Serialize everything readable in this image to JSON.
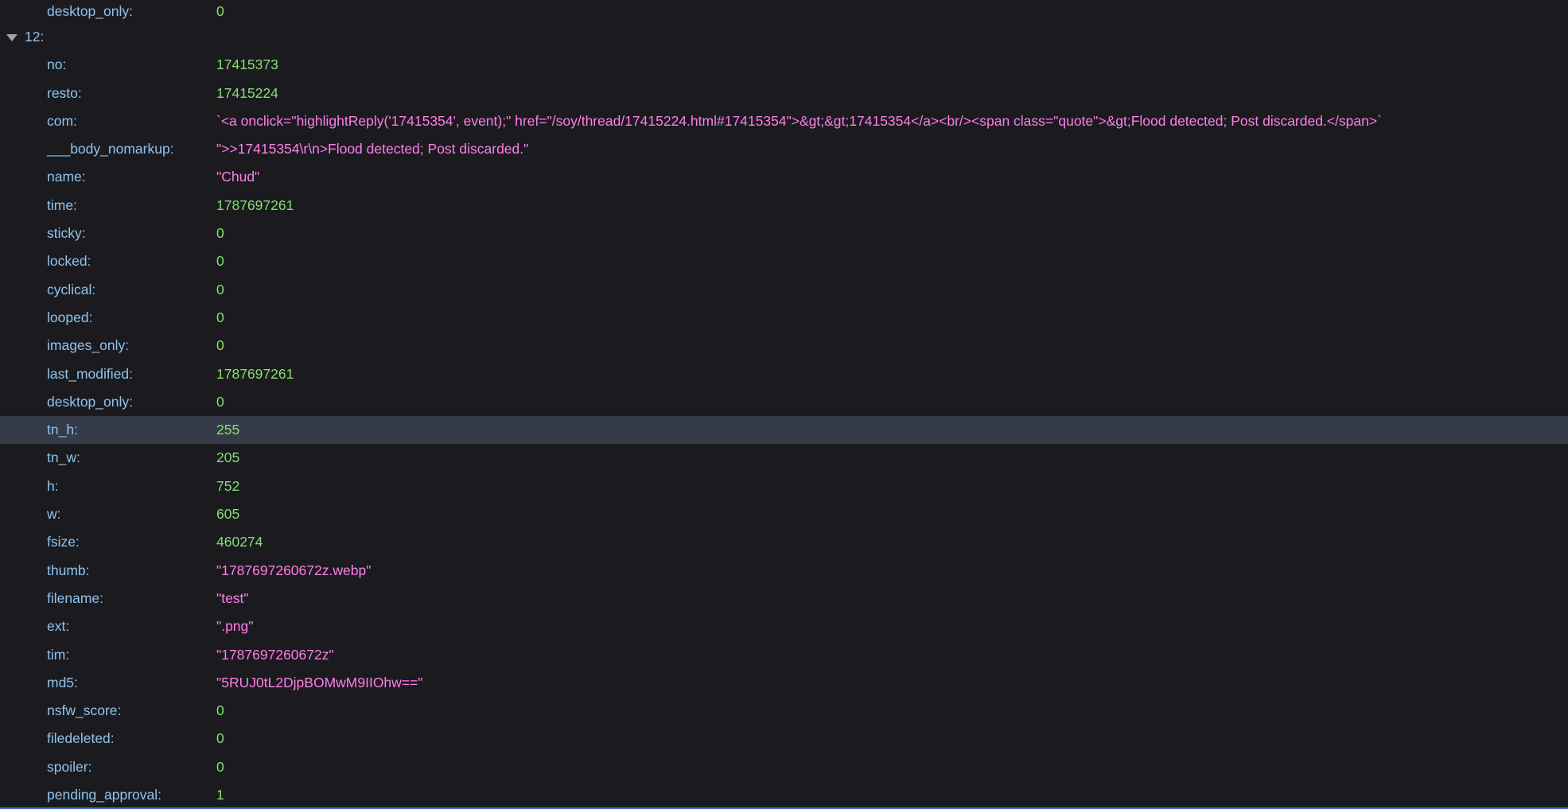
{
  "top_row": {
    "key": "desktop_only:",
    "value": "0"
  },
  "group": {
    "label": "12:"
  },
  "rows": [
    {
      "key": "no:",
      "value": "17415373",
      "type": "num"
    },
    {
      "key": "resto:",
      "value": "17415224",
      "type": "num"
    },
    {
      "key": "com:",
      "value": "`<a onclick=\"highlightReply('17415354', event);\" href=\"/soy/thread/17415224.html#17415354\">&gt;&gt;17415354</a><br/><span class=\"quote\">&gt;Flood detected; Post discarded.</span>`",
      "type": "str"
    },
    {
      "key": "___body_nomarkup:",
      "value": "\">>17415354\\r\\n>Flood detected; Post discarded.\"",
      "type": "str"
    },
    {
      "key": "name:",
      "value": "\"Chud\"",
      "type": "str"
    },
    {
      "key": "time:",
      "value": "1787697261",
      "type": "num"
    },
    {
      "key": "sticky:",
      "value": "0",
      "type": "num"
    },
    {
      "key": "locked:",
      "value": "0",
      "type": "num"
    },
    {
      "key": "cyclical:",
      "value": "0",
      "type": "num"
    },
    {
      "key": "looped:",
      "value": "0",
      "type": "num"
    },
    {
      "key": "images_only:",
      "value": "0",
      "type": "num"
    },
    {
      "key": "last_modified:",
      "value": "1787697261",
      "type": "num"
    },
    {
      "key": "desktop_only:",
      "value": "0",
      "type": "num"
    },
    {
      "key": "tn_h:",
      "value": "255",
      "type": "num",
      "selected": true
    },
    {
      "key": "tn_w:",
      "value": "205",
      "type": "num"
    },
    {
      "key": "h:",
      "value": "752",
      "type": "num"
    },
    {
      "key": "w:",
      "value": "605",
      "type": "num"
    },
    {
      "key": "fsize:",
      "value": "460274",
      "type": "num"
    },
    {
      "key": "thumb:",
      "value": "\"1787697260672z.webp\"",
      "type": "str"
    },
    {
      "key": "filename:",
      "value": "\"test\"",
      "type": "str"
    },
    {
      "key": "ext:",
      "value": "\".png\"",
      "type": "str"
    },
    {
      "key": "tim:",
      "value": "\"1787697260672z\"",
      "type": "str"
    },
    {
      "key": "md5:",
      "value": "\"5RUJ0tL2DjpBOMwM9IIOhw==\"",
      "type": "str"
    },
    {
      "key": "nsfw_score:",
      "value": "0",
      "type": "num"
    },
    {
      "key": "filedeleted:",
      "value": "0",
      "type": "num"
    },
    {
      "key": "spoiler:",
      "value": "0",
      "type": "num"
    },
    {
      "key": "pending_approval:",
      "value": "1",
      "type": "num"
    }
  ],
  "colors": {
    "background": "#1b1b1f",
    "key": "#8fc3ef",
    "number": "#86de74",
    "string": "#ff7de9",
    "selected_row": "#353b48"
  }
}
